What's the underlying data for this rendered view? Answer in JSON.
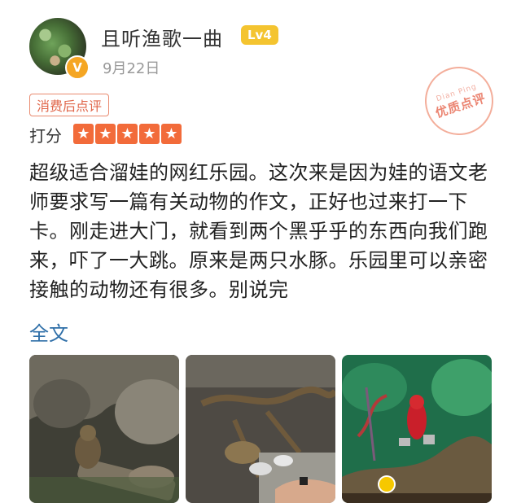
{
  "user": {
    "name": "且听渔歌一曲",
    "level": "Lv4",
    "verified_badge": "V",
    "date": "9月22日"
  },
  "stamp": {
    "en": "Dian Ping",
    "cn": "优质点评"
  },
  "tag": "消费后点评",
  "rating": {
    "label": "打分",
    "stars": 5,
    "star_glyph": "★",
    "star_color": "#f26b3a"
  },
  "review": {
    "text": "超级适合溜娃的网红乐园。这次来是因为娃的语文老师要求写一篇有关动物的作文，正好也过来打一下卡。刚走进大门，就看到两个黑乎乎的东西向我们跑来，吓了一大跳。原来是两只水豚。乐园里可以亲密接触的动物还有很多。别说完",
    "more_link": "全文"
  },
  "photos": [
    {
      "icon": "capybara-photo"
    },
    {
      "icon": "birds-branch-photo"
    },
    {
      "icon": "parrot-photo"
    }
  ],
  "colors": {
    "accent": "#f26b3a",
    "link": "#2f6fa8",
    "level_bg": "#f4c430"
  }
}
